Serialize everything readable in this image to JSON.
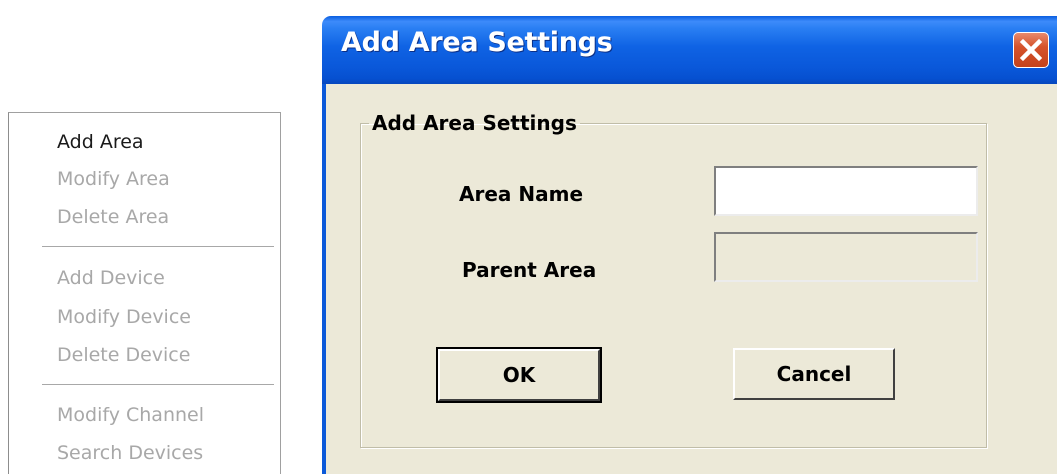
{
  "context_menu": {
    "items": [
      {
        "label": "Add Area",
        "enabled": true
      },
      {
        "label": "Modify Area",
        "enabled": false
      },
      {
        "label": "Delete Area",
        "enabled": false
      },
      {
        "label": "Add Device",
        "enabled": false
      },
      {
        "label": "Modify Device",
        "enabled": false
      },
      {
        "label": "Delete Device",
        "enabled": false
      },
      {
        "label": "Modify Channel",
        "enabled": false
      },
      {
        "label": "Search Devices",
        "enabled": false
      }
    ]
  },
  "dialog": {
    "title": "Add Area Settings",
    "close_icon": "close-icon",
    "group_title": "Add Area Settings",
    "fields": {
      "area_name_label": "Area Name",
      "area_name_value": "",
      "parent_area_label": "Parent Area",
      "parent_area_value": ""
    },
    "buttons": {
      "ok": "OK",
      "cancel": "Cancel"
    }
  },
  "colors": {
    "titlebar": "#0a58da",
    "dialog_background": "#ece9d8",
    "close_button": "#d6532c",
    "menu_disabled_text": "#a8a8a8",
    "menu_enabled_text": "#1a1a1a"
  }
}
